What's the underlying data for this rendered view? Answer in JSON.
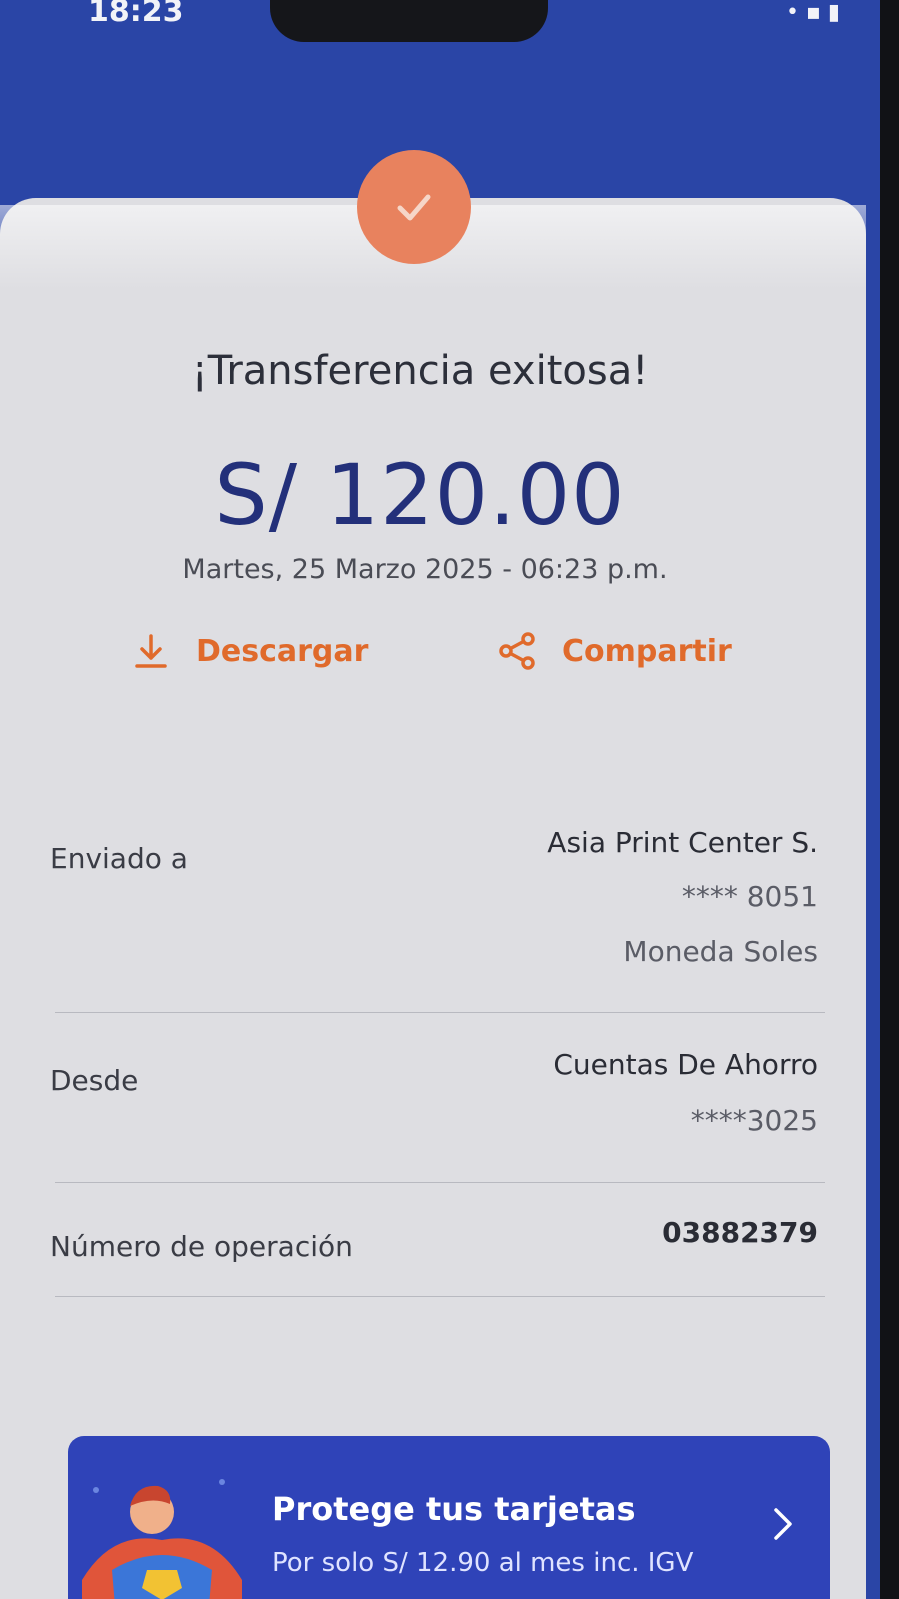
{
  "status_bar": {
    "time": "18:23",
    "indicators": "• ▪ ▮"
  },
  "receipt": {
    "title": "¡Transferencia exitosa!",
    "amount": "S/ 120.00",
    "datetime": "Martes, 25 Marzo 2025 - 06:23 p.m.",
    "success_icon": "check-icon"
  },
  "actions": {
    "download_label": "Descargar",
    "download_icon": "download-icon",
    "share_label": "Compartir",
    "share_icon": "share-icon"
  },
  "details": {
    "sent_to": {
      "label": "Enviado a",
      "name": "Asia Print Center S.",
      "account": "**** 8051",
      "currency": "Moneda Soles"
    },
    "from": {
      "label": "Desde",
      "account_type": "Cuentas De Ahorro",
      "account": "****3025"
    },
    "operation": {
      "label": "Número de operación",
      "number": "03882379"
    }
  },
  "promo": {
    "title": "Protege tus tarjetas",
    "subtitle": "Por solo S/ 12.90 al mes inc. IGV",
    "chevron_icon": "chevron-right-icon"
  },
  "colors": {
    "header_blue": "#2a45a6",
    "accent_orange": "#e06a2b",
    "amount_navy": "#23307a",
    "promo_blue": "#2f43b8"
  }
}
